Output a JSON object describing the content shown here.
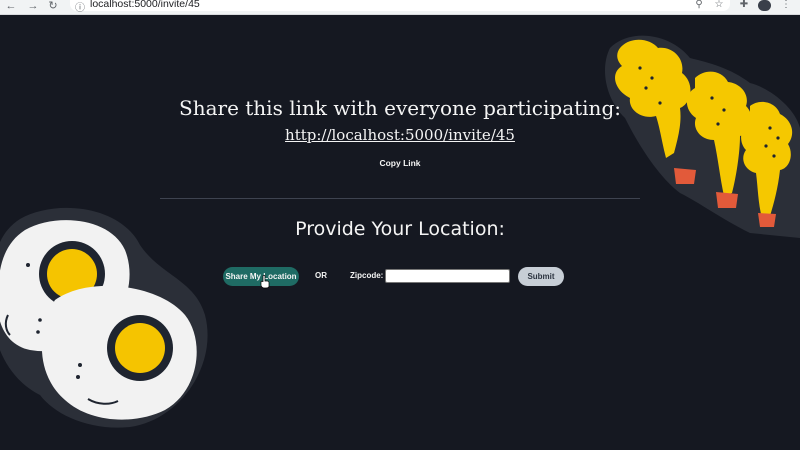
{
  "browser": {
    "url": "localhost:5000/invite/45",
    "back_glyph": "←",
    "forward_glyph": "→",
    "reload_glyph": "↻",
    "info_glyph": "ⓘ",
    "zoom_glyph": "⚲",
    "star_glyph": "☆",
    "extensions_glyph": "✚",
    "menu_glyph": "⋮"
  },
  "share": {
    "title": "Share this link with everyone participating:",
    "link": "http://localhost:5000/invite/45",
    "copy_label": "Copy Link"
  },
  "location": {
    "title": "Provide Your Location:",
    "share_button": "Share My Location",
    "or_text": "OR",
    "zip_label": "Zipcode:",
    "zip_value": "",
    "submit_label": "Submit"
  },
  "colors": {
    "background": "#151821",
    "share_button": "#1f6b64",
    "submit_button": "#c7ced6",
    "egg_yolk": "#f5c400",
    "fries": "#f5c800"
  }
}
